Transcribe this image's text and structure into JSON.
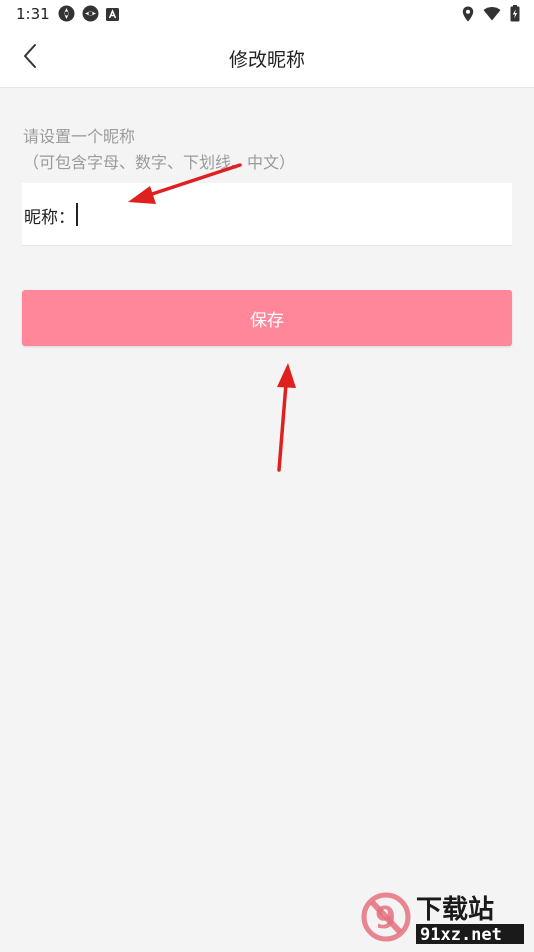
{
  "status_bar": {
    "time": "1:31",
    "left_icons": [
      "aperture-icon",
      "aperture-icon",
      "font-a-icon"
    ],
    "right_icons": [
      "location-icon",
      "wifi-icon",
      "battery-charging-icon"
    ]
  },
  "header": {
    "title": "修改昵称",
    "back_icon": "chevron-left-icon"
  },
  "form": {
    "hint_line1": "请设置一个昵称",
    "hint_line2": "（可包含字母、数字、下划线、中文）",
    "nickname_label": "昵称：",
    "nickname_value": "",
    "nickname_placeholder": ""
  },
  "actions": {
    "save_label": "保存"
  },
  "watermark": {
    "logo_text": "下载站",
    "url_text": "91xz.net"
  },
  "colors": {
    "accent": "#ff8799",
    "annotation_arrow": "#e0201e",
    "background": "#f4f4f4"
  }
}
